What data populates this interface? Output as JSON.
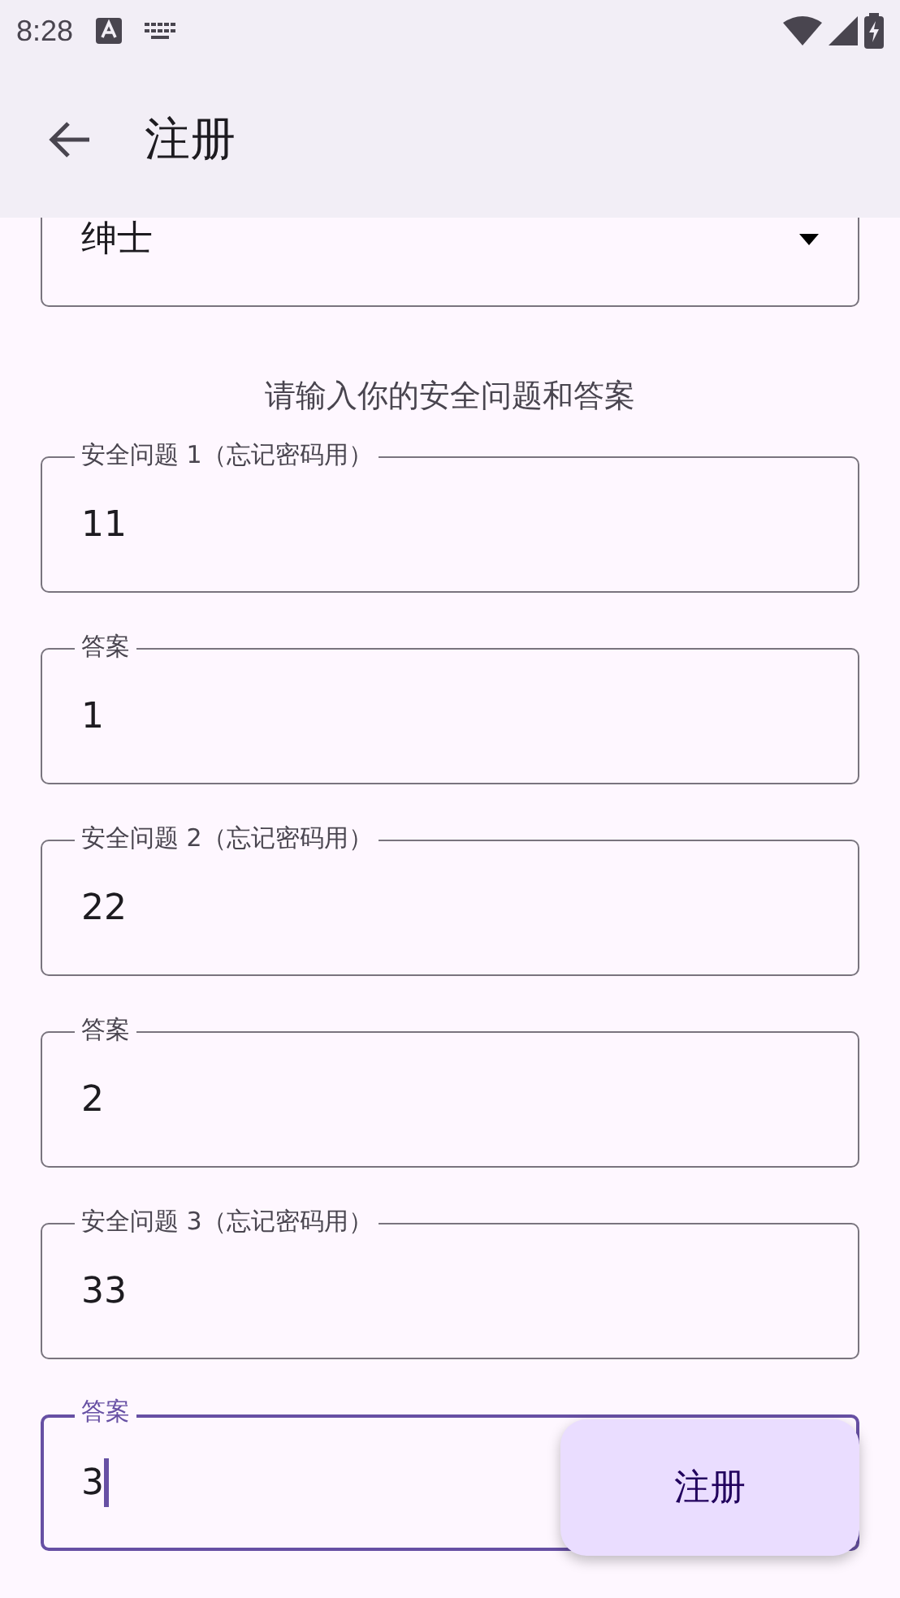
{
  "status_bar": {
    "time": "8:28"
  },
  "app_bar": {
    "title": "注册"
  },
  "dropdown": {
    "value": "绅士"
  },
  "hint": "请输入你的安全问题和答案",
  "fields": [
    {
      "label": "安全问题 1（忘记密码用）",
      "value": "11",
      "focused": false
    },
    {
      "label": "答案",
      "value": "1",
      "focused": false
    },
    {
      "label": "安全问题 2（忘记密码用）",
      "value": "22",
      "focused": false
    },
    {
      "label": "答案",
      "value": "2",
      "focused": false
    },
    {
      "label": "安全问题 3（忘记密码用）",
      "value": "33",
      "focused": false
    },
    {
      "label": "答案",
      "value": "3",
      "focused": true
    }
  ],
  "fab": {
    "label": "注册"
  }
}
